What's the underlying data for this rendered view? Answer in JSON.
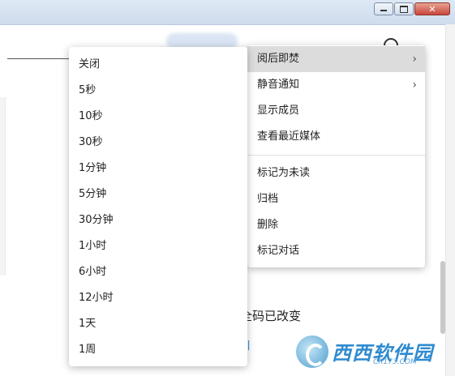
{
  "submenu": {
    "items": [
      "关闭",
      "5秒",
      "10秒",
      "30秒",
      "1分钟",
      "5分钟",
      "30分钟",
      "1小时",
      "6小时",
      "12小时",
      "1天",
      "1周"
    ]
  },
  "context_menu": {
    "items_top": [
      {
        "label": "阅后即焚",
        "has_submenu": true
      },
      {
        "label": "静音通知",
        "has_submenu": true
      },
      {
        "label": "显示成员",
        "has_submenu": false
      },
      {
        "label": "查看最近媒体",
        "has_submenu": false
      }
    ],
    "items_bottom": [
      {
        "label": "标记为未读"
      },
      {
        "label": "归档"
      },
      {
        "label": "删除"
      },
      {
        "label": "标记对话"
      }
    ],
    "chevron": "›"
  },
  "background": {
    "notice_text": "全码已改变",
    "link_fragment": "引"
  },
  "watermark": {
    "title": "西西软件园",
    "sub": "CR173.COM"
  },
  "window": {
    "close_glyph": "✕"
  }
}
